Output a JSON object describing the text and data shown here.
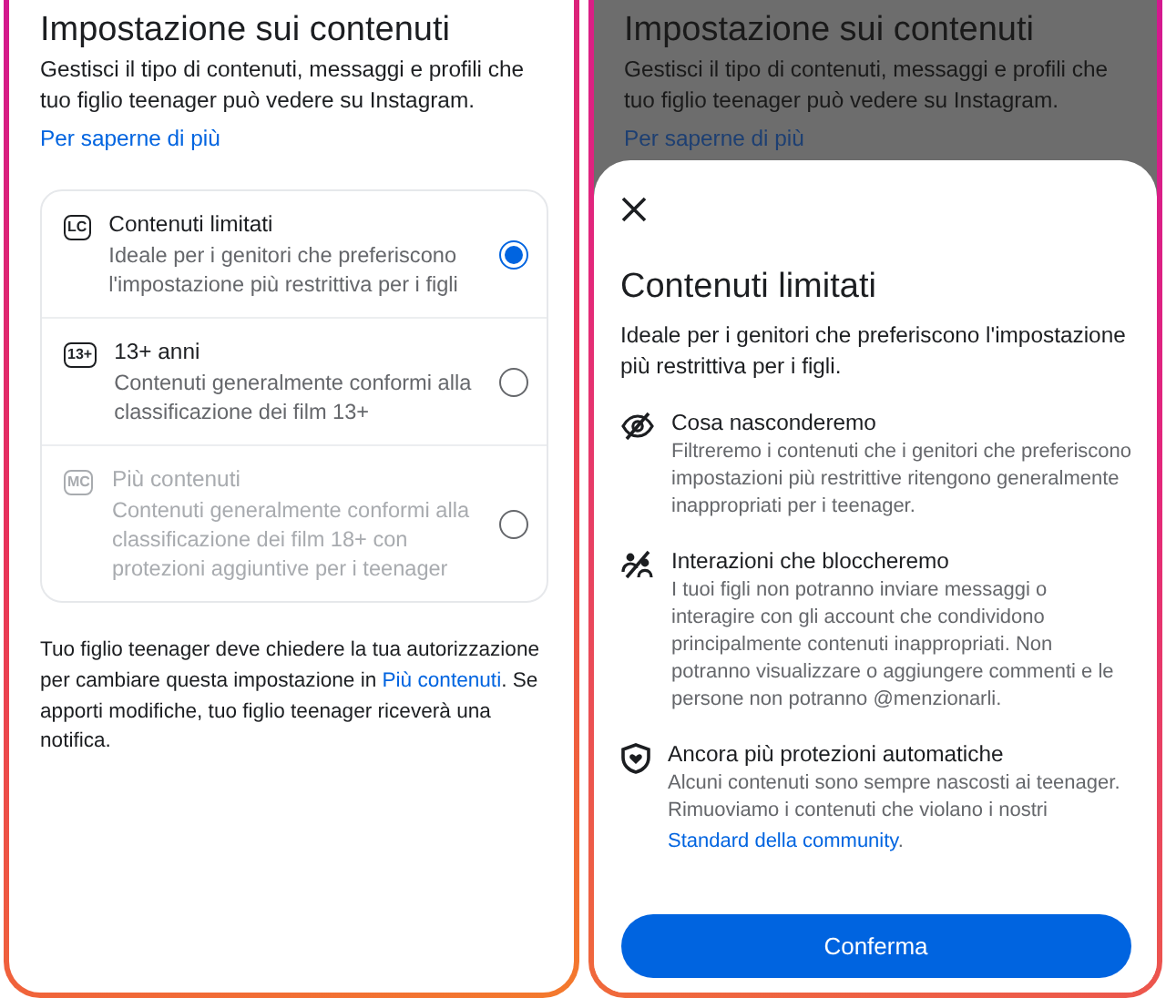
{
  "left_screen": {
    "title": "Impostazione sui contenuti",
    "description": "Gestisci il tipo di contenuti, messaggi e profili che tuo figlio teenager può vedere su Instagram.",
    "learn_more": "Per saperne di più",
    "options": [
      {
        "badge": "LC",
        "label": "Contenuti limitati",
        "description": "Ideale per i genitori che preferiscono l'impostazione più restrittiva per i figli",
        "selected": true,
        "disabled": false
      },
      {
        "badge": "13+",
        "label": "13+ anni",
        "description": "Contenuti generalmente conformi alla classificazione dei film 13+",
        "selected": false,
        "disabled": false
      },
      {
        "badge": "MC",
        "label": "Più contenuti",
        "description": "Contenuti generalmente conformi alla classificazione dei film 18+ con protezioni aggiuntive per i teenager",
        "selected": false,
        "disabled": true
      }
    ],
    "footer": [
      {
        "kind": "text",
        "text": "Tuo figlio teenager deve chiedere la tua autorizzazione per cambiare questa impostazione in "
      },
      {
        "kind": "link",
        "text": "Più contenuti"
      },
      {
        "kind": "text",
        "text": ". Se apporti modifiche, tuo figlio teenager riceverà una notifica."
      }
    ]
  },
  "right_screen": {
    "background": {
      "title": "Impostazione sui contenuti",
      "description": "Gestisci il tipo di contenuti, messaggi e profili che tuo figlio teenager può vedere su Instagram.",
      "learn_more": "Per saperne di più"
    },
    "sheet": {
      "title": "Contenuti limitati",
      "description": "Ideale per i genitori che preferiscono l'impostazione più restrittiva per i figli.",
      "items": [
        {
          "kind": "hidden",
          "heading": "Cosa nasconderemo",
          "text": [
            {
              "kind": "text",
              "text": "Filtreremo i contenuti che i genitori che preferiscono impostazioni più restrittive ritengono generalmente inappropriati per i teenager."
            }
          ]
        },
        {
          "kind": "blocked",
          "heading": "Interazioni che bloccheremo",
          "text": [
            {
              "kind": "text",
              "text": "I tuoi figli non potranno inviare messaggi o interagire con gli account che condividono principalmente contenuti inappropriati. Non potranno visualizzare o aggiungere commenti e le persone non potranno @menzionarli."
            }
          ]
        },
        {
          "kind": "protection",
          "heading": "Ancora più protezioni automatiche",
          "text": [
            {
              "kind": "text",
              "text": "Alcuni contenuti sono sempre nascosti ai teenager. Rimuoviamo i contenuti che violano i nostri "
            },
            {
              "kind": "link",
              "text": "Standard della community"
            },
            {
              "kind": "text",
              "text": "."
            }
          ]
        }
      ],
      "button": "Conferma"
    }
  }
}
